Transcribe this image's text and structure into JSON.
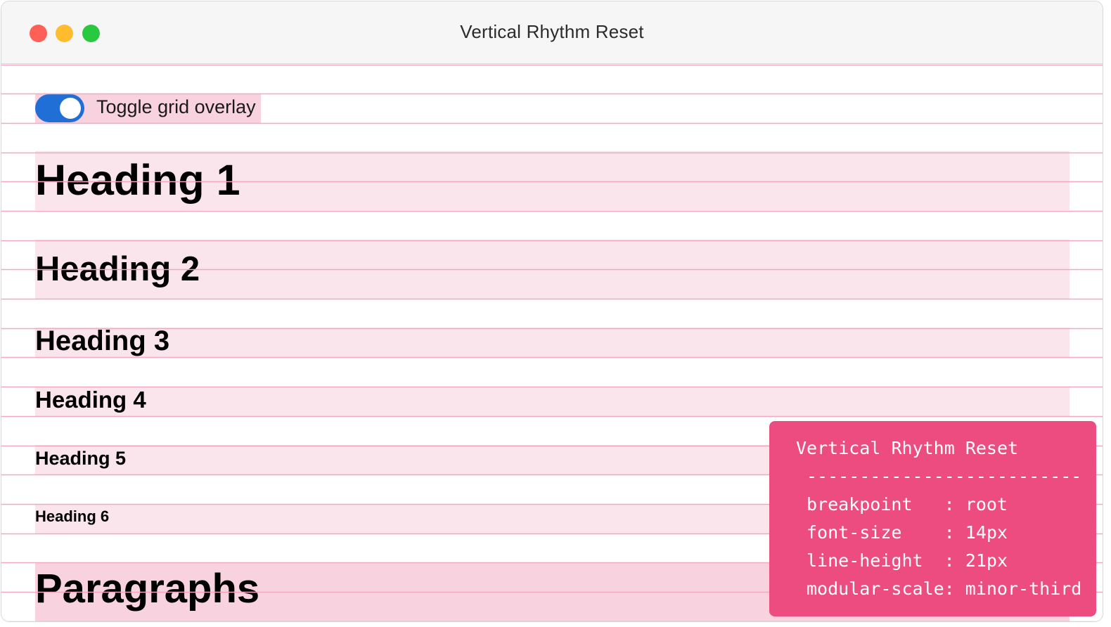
{
  "window": {
    "title": "Vertical Rhythm Reset"
  },
  "toggle": {
    "label": "Toggle grid overlay",
    "checked": true,
    "accent_color": "#1f6fd6"
  },
  "headings": {
    "h1": "Heading 1",
    "h2": "Heading 2",
    "h3": "Heading 3",
    "h4": "Heading 4",
    "h5": "Heading 5",
    "h6": "Heading 6",
    "paragraphs": "Paragraphs"
  },
  "info_panel": {
    "title": "Vertical Rhythm Reset",
    "rule": "--------------------------",
    "rows": [
      {
        "key": "breakpoint",
        "value": "root"
      },
      {
        "key": "font-size",
        "value": "14px"
      },
      {
        "key": "line-height",
        "value": "21px"
      },
      {
        "key": "modular-scale",
        "value": "minor-third"
      }
    ],
    "background_color": "#ec4c80"
  },
  "colors": {
    "grid_line": "#f2a9c0",
    "band": "#fbe5ec",
    "band_strong": "#f9d2df"
  }
}
